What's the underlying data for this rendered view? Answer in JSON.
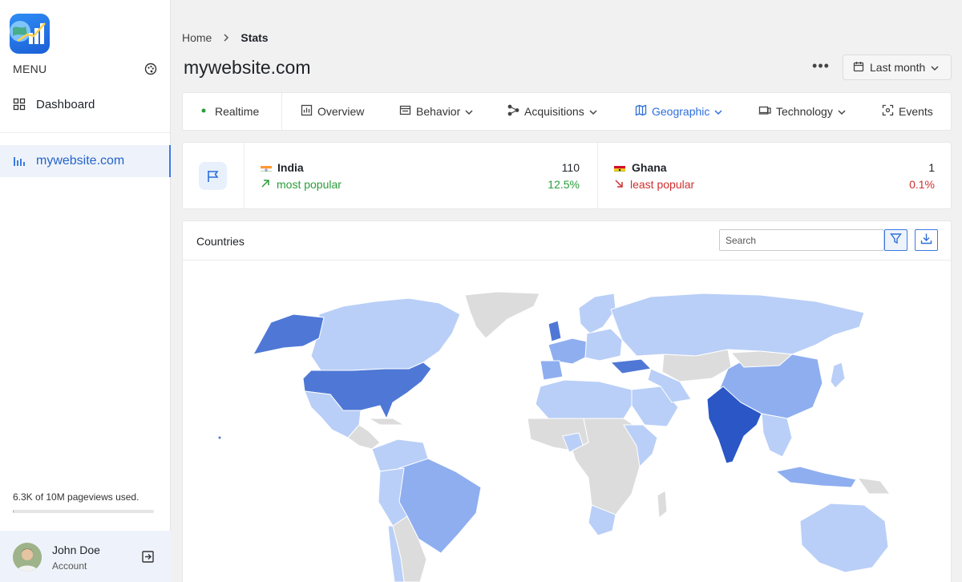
{
  "sidebar": {
    "menu_label": "MENU",
    "nav": [
      {
        "label": "Dashboard",
        "icon": "grid-icon"
      },
      {
        "label": "mywebsite.com",
        "icon": "bar-chart-icon",
        "active": true
      }
    ],
    "usage_text": "6.3K of 10M pageviews used.",
    "usage_fraction": 0.00063,
    "user": {
      "name": "John Doe",
      "role": "Account"
    }
  },
  "header": {
    "breadcrumbs": [
      "Home",
      "Stats"
    ],
    "title": "mywebsite.com",
    "date_range": "Last month"
  },
  "tabs": [
    {
      "label": "Realtime",
      "icon": "live-dot-icon"
    },
    {
      "label": "Overview",
      "icon": "chart-icon"
    },
    {
      "label": "Behavior",
      "icon": "browser-icon",
      "dropdown": true
    },
    {
      "label": "Acquisitions",
      "icon": "nodes-icon",
      "dropdown": true
    },
    {
      "label": "Geographic",
      "icon": "map-icon",
      "dropdown": true,
      "active": true
    },
    {
      "label": "Technology",
      "icon": "devices-icon",
      "dropdown": true
    },
    {
      "label": "Events",
      "icon": "target-icon"
    }
  ],
  "stats": {
    "most": {
      "country": "India",
      "label": "most popular",
      "count": "110",
      "percent": "12.5%"
    },
    "least": {
      "country": "Ghana",
      "label": "least popular",
      "count": "1",
      "percent": "0.1%"
    }
  },
  "countries": {
    "title": "Countries",
    "search_placeholder": "Search"
  },
  "colors": {
    "accent": "#2e6fd9",
    "map_high": "#2a56c6",
    "map_mid": "#8faef0",
    "map_low": "#b9cff7",
    "map_none": "#dcdcdc"
  }
}
